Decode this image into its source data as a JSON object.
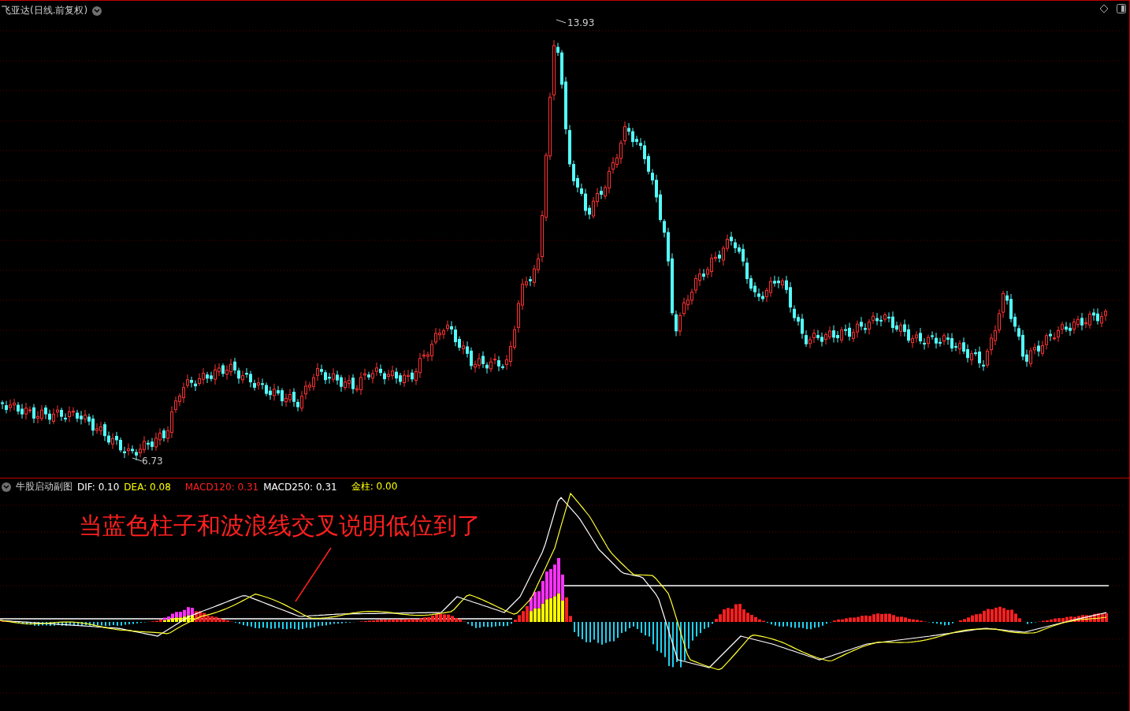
{
  "title": "飞亚达(日线.前复权)",
  "price_high": "13.93",
  "price_low": "6.73",
  "indicator": {
    "name": "牛股启动副图",
    "values": [
      {
        "label": "DIF:",
        "value": "0.10",
        "color": "#ffffff"
      },
      {
        "label": "DEA:",
        "value": "0.08",
        "color": "#ffff00"
      },
      {
        "label": "MACD120:",
        "value": "0.31",
        "color": "#ff2020"
      },
      {
        "label": "MACD250:",
        "value": "0.31",
        "color": "#ffffff"
      },
      {
        "label": "金柱:",
        "value": "0.00",
        "color": "#ffff00"
      }
    ]
  },
  "annotation": "当蓝色柱子和波浪线交叉说明低位到了"
}
